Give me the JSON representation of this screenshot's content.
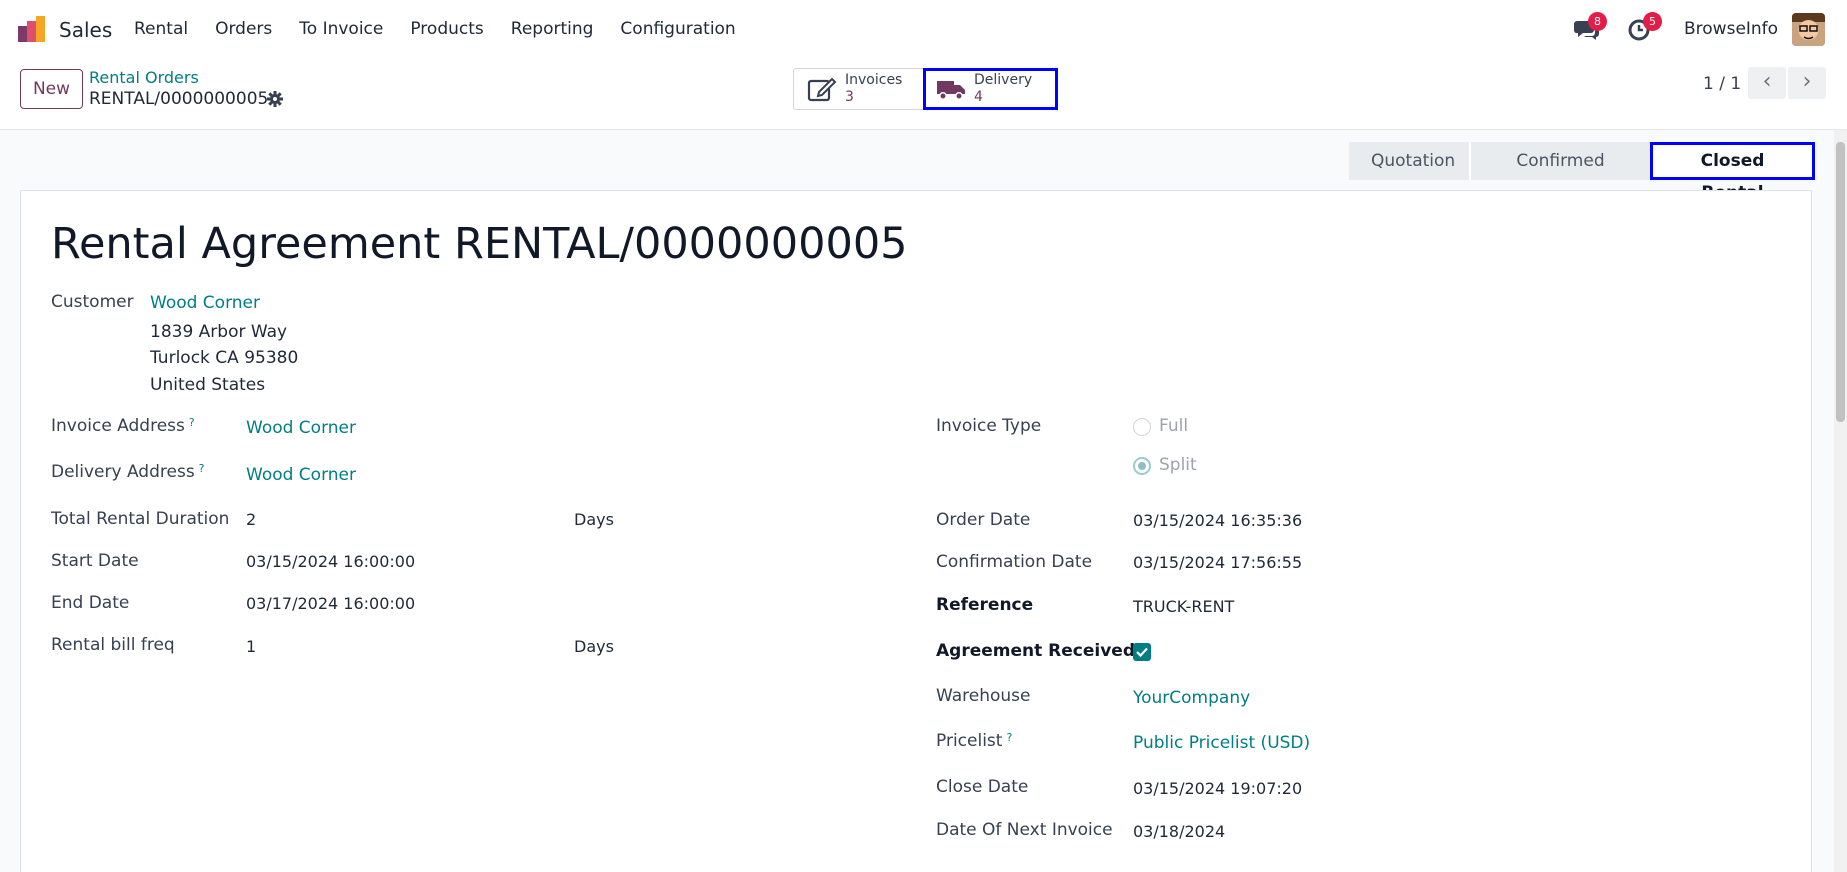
{
  "navbar": {
    "app_name": "Sales",
    "menu": [
      "Rental",
      "Orders",
      "To Invoice",
      "Products",
      "Reporting",
      "Configuration"
    ],
    "messages_count": "8",
    "activities_count": "5",
    "user_name": "BrowseInfo"
  },
  "control": {
    "new_label": "New",
    "breadcrumb_parent": "Rental Orders",
    "breadcrumb_current": "RENTAL/0000000005",
    "smart_buttons": {
      "invoices": {
        "label": "Invoices",
        "count": "3"
      },
      "delivery": {
        "label": "Delivery",
        "count": "4"
      }
    },
    "pager": "1 / 1"
  },
  "status": {
    "stages": [
      "Quotation",
      "Confirmed Rental",
      "Closed Rental"
    ],
    "current": "Closed Rental"
  },
  "form": {
    "title": "Rental Agreement RENTAL/0000000005",
    "customer": {
      "label": "Customer",
      "name": "Wood Corner",
      "address_line1": "1839 Arbor Way",
      "address_line2": "Turlock CA 95380",
      "address_line3": "United States"
    },
    "left": {
      "invoice_address": {
        "label": "Invoice Address",
        "help": "?",
        "value": "Wood Corner"
      },
      "delivery_address": {
        "label": "Delivery Address",
        "help": "?",
        "value": "Wood Corner"
      },
      "total_rental_duration": {
        "label": "Total Rental Duration",
        "value": "2",
        "unit": "Days"
      },
      "start_date": {
        "label": "Start Date",
        "value": "03/15/2024 16:00:00"
      },
      "end_date": {
        "label": "End Date",
        "value": "03/17/2024 16:00:00"
      },
      "rental_bill_freq": {
        "label": "Rental bill freq",
        "value": "1",
        "unit": "Days"
      }
    },
    "right": {
      "invoice_type": {
        "label": "Invoice Type",
        "options": [
          "Full",
          "Split"
        ],
        "selected": "Split"
      },
      "order_date": {
        "label": "Order Date",
        "value": "03/15/2024 16:35:36"
      },
      "confirmation_date": {
        "label": "Confirmation Date",
        "value": "03/15/2024 17:56:55"
      },
      "reference": {
        "label": "Reference",
        "value": "TRUCK-RENT"
      },
      "agreement_received": {
        "label": "Agreement Received?",
        "checked": true
      },
      "warehouse": {
        "label": "Warehouse",
        "value": "YourCompany"
      },
      "pricelist": {
        "label": "Pricelist",
        "help": "?",
        "value": "Public Pricelist (USD)"
      },
      "close_date": {
        "label": "Close Date",
        "value": "03/15/2024 19:07:20"
      },
      "next_invoice_date": {
        "label": "Date Of Next Invoice",
        "value": "03/18/2024"
      }
    }
  },
  "colors": {
    "brand": "#71395f",
    "link": "#017e84",
    "highlight": "#0000ff",
    "badge": "#e11d48"
  }
}
